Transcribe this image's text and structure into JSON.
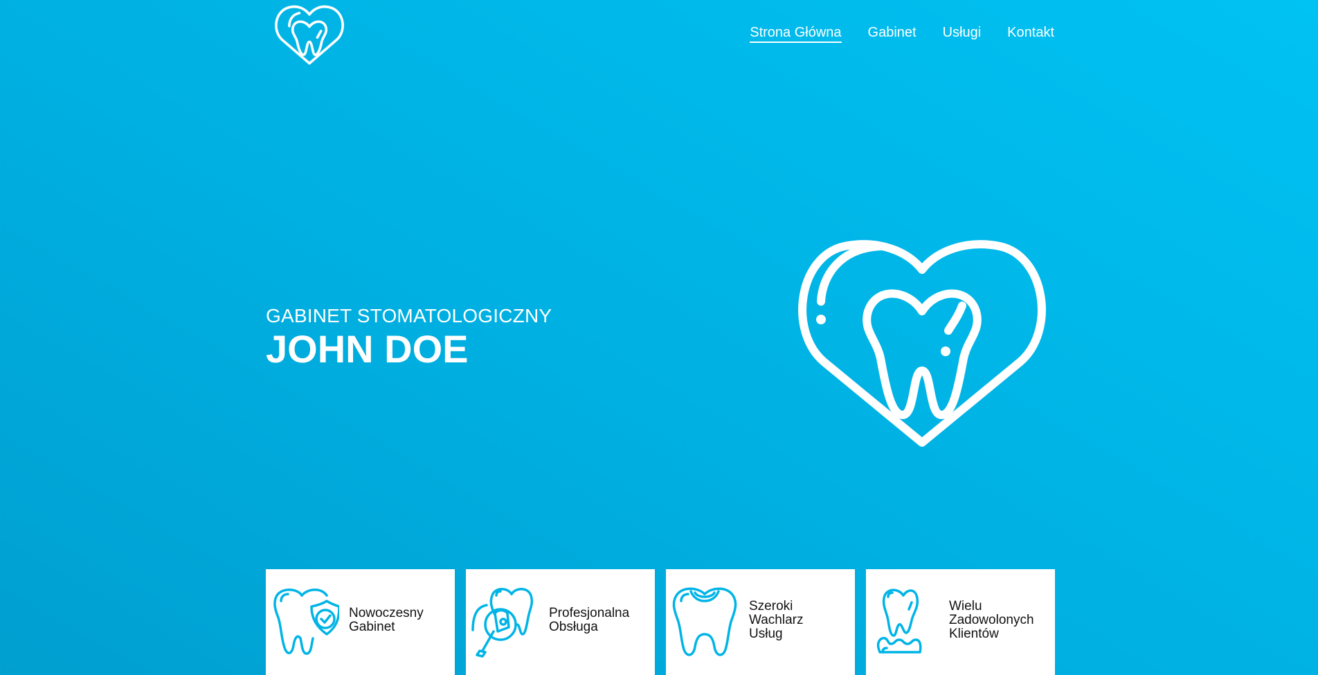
{
  "colors": {
    "background_start": "#009fd0",
    "background_end": "#00c2f3",
    "accent": "#00b4e6",
    "text_light": "#ffffff",
    "text_dark": "#111111"
  },
  "header": {
    "logo_icon": "heart-tooth-icon",
    "nav": [
      {
        "label": "Strona Główna",
        "active": true
      },
      {
        "label": "Gabinet",
        "active": false
      },
      {
        "label": "Usługi",
        "active": false
      },
      {
        "label": "Kontakt",
        "active": false
      }
    ]
  },
  "hero": {
    "subtitle": "GABINET STOMATOLOGICZNY",
    "title": "JOHN DOE",
    "illustration_icon": "heart-tooth-icon"
  },
  "features": [
    {
      "icon": "tooth-shield-check-icon",
      "label": "Nowoczesny\nGabinet"
    },
    {
      "icon": "tooth-dental-tool-icon",
      "label": "Profesjonalna\nObsługa"
    },
    {
      "icon": "tooth-filling-icon",
      "label": "Szeroki\nWachlarz\nUsług"
    },
    {
      "icon": "tooth-jaw-icon",
      "label": "Wielu\nZadowolonych\nKlientów"
    }
  ]
}
